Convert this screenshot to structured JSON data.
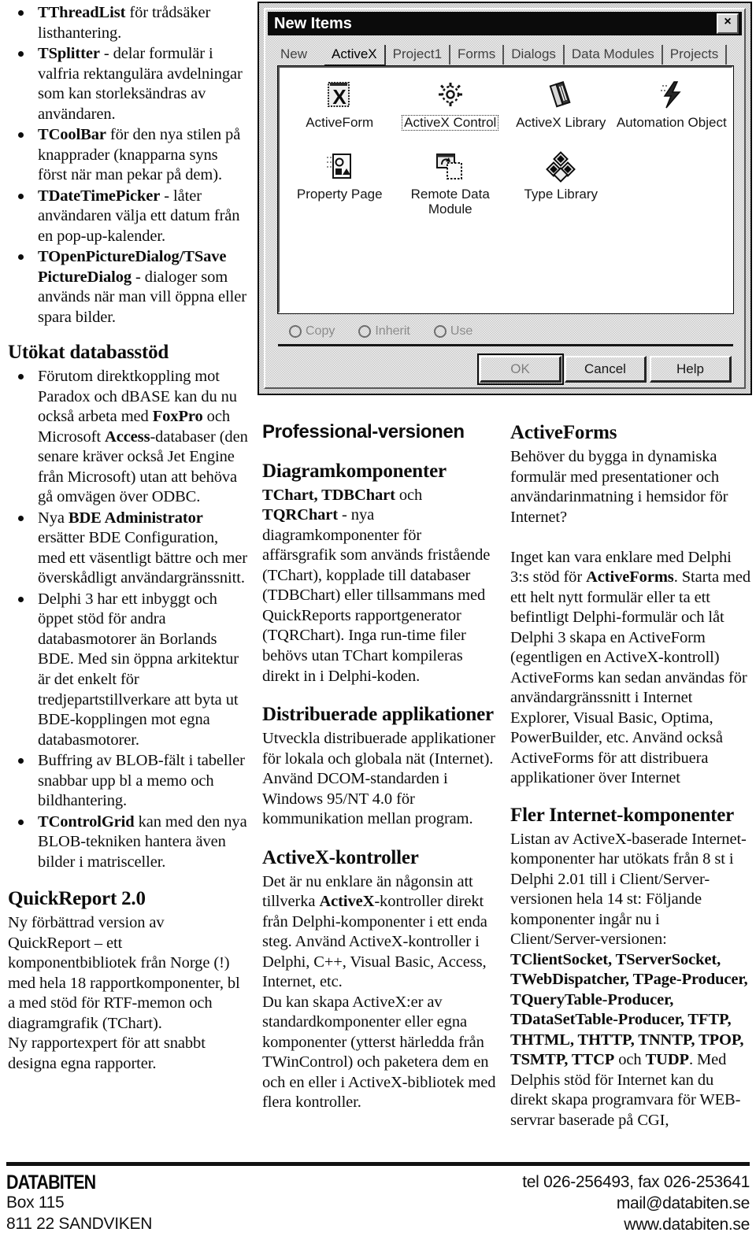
{
  "left_column": {
    "bullets_top": [
      {
        "html": "<b>TThreadList</b> för trådsäker listhantering."
      },
      {
        "html": "<b>TSplitter</b> - delar formulär i valfria rektangulära avdelningar som kan storleksändras av användaren."
      },
      {
        "html": "<b>TCoolBar</b> för den nya stilen på knapprader (knapparna syns först när man pekar på dem)."
      },
      {
        "html": "<b>TDateTimePicker</b> - låter användaren välja ett datum från en pop-up-kalender."
      },
      {
        "html": "<b>TOpenPictureDialog/TSave PictureDialog</b> - dialoger som används när man vill öppna eller spara bilder."
      }
    ],
    "section_db": {
      "heading": "Utökat databasstöd",
      "bullets": [
        {
          "html": "Förutom direktkoppling mot Paradox och dBASE kan du nu också arbeta med <b>FoxPro</b> och Microsoft <b>Access</b>-databaser (den senare kräver också Jet Engine från Microsoft) utan att behöva gå omvägen över ODBC."
        },
        {
          "html": "Nya <b>BDE Administrator</b> ersätter BDE Configuration, med ett väsentligt bättre och mer överskådligt användargränssnitt."
        },
        {
          "html": "Delphi 3 har ett inbyggt och öppet stöd för andra databasmotorer än Borlands BDE. Med sin öppna arkitektur är det enkelt för tredjepartstillverkare att byta ut BDE-kopplingen mot egna databasmotorer."
        },
        {
          "html": "Buffring av BLOB-fält i tabeller snabbar upp bl a memo och bildhantering."
        },
        {
          "html": "<b>TControlGrid</b> kan med den nya BLOB-tekniken hantera även bilder i matrisceller."
        }
      ]
    },
    "section_quickreport": {
      "heading": "QuickReport 2.0",
      "paragraphs": [
        "Ny förbättrad version av QuickReport – ett komponentbibliotek från Norge (!) med hela 18 rapportkomponenter, bl a med stöd för RTF-memon och diagramgrafik (TChart).",
        "Ny rapportexpert för att snabbt designa egna rapporter."
      ]
    }
  },
  "mid_column": {
    "kicker": "Professional-versionen",
    "section_chart": {
      "heading": "Diagramkomponenter",
      "body_html": "<b>TChart, TDBChart</b> och <b>TQRChart</b> - nya diagramkomponenter för affärsgrafik som används fristående (TChart), kopplade till databaser (TDBChart) eller tillsammans med QuickReports rapportgenerator (TQRChart). Inga run-time filer behövs utan TChart kompileras direkt in i Delphi-koden."
    },
    "section_distributed": {
      "heading": "Distribuerade applikationer",
      "body_html": "Utveckla distribuerade applikationer för lokala och globala nät (Internet). Använd DCOM-standarden i Windows 95/NT 4.0 för kommunikation mellan program."
    },
    "section_activex": {
      "heading": "ActiveX-kontroller",
      "body_html": "Det är nu enklare än någonsin att tillverka <b>ActiveX</b>-kontroller direkt från Delphi-komponenter i ett enda steg. Använd ActiveX-kontroller i Delphi, C++, Visual Basic, Access, Internet, etc.<br>Du kan skapa ActiveX:er av standardkomponenter eller egna komponenter (ytterst härledda från TWinControl) och paketera dem en och en eller i ActiveX-bibliotek med flera kontroller."
    }
  },
  "right_column": {
    "section_activeforms": {
      "heading": "ActiveForms",
      "body_html": "Behöver du bygga in dynamiska formulär med presentationer och användarinmatning i hemsidor för Internet?<br><br>Inget kan vara enklare med Delphi 3:s stöd för <b>ActiveForms</b>. Starta med ett helt nytt formulär  eller ta ett befintligt Delphi-formulär och låt Delphi 3 skapa en ActiveForm (egentligen en ActiveX-kontroll) ActiveForms kan sedan användas för användargränssnitt i Internet Explorer, Visual Basic, Optima, PowerBuilder, etc.  Använd också ActiveForms för att distribuera applikationer över Internet"
    },
    "section_internet": {
      "heading": "Fler Internet-komponenter",
      "body_html": "Listan av ActiveX-baserade Internet-komponenter har utökats från 8 st i Delphi 2.01 till i Client/Server-versionen hela 14 st: Följande komponenter ingår nu i Client/Server-versionen: <b>TClientSocket, TServerSocket, TWebDispatcher, TPage-Producer, TQueryTable-Producer, TDataSetTable-Producer, TFTP, THTML, THTTP, TNNTP, TPOP, TSMTP, TTCP</b> och <b>TUDP</b>. Med Delphis stöd för Internet kan du direkt skapa programvara för WEB-servrar baserade på CGI,"
    }
  },
  "dialog": {
    "title": "New Items",
    "close_label": "×",
    "tabs": [
      {
        "label": "New",
        "active": false
      },
      {
        "label": "ActiveX",
        "active": true
      },
      {
        "label": "Project1",
        "active": false
      },
      {
        "label": "Forms",
        "active": false
      },
      {
        "label": "Dialogs",
        "active": false
      },
      {
        "label": "Data Modules",
        "active": false
      },
      {
        "label": "Projects",
        "active": false
      }
    ],
    "items": [
      {
        "label": "ActiveForm",
        "icon": "activeform-icon",
        "selected": false
      },
      {
        "label": "ActiveX Control",
        "icon": "activex-control-icon",
        "selected": true
      },
      {
        "label": "ActiveX Library",
        "icon": "activex-library-icon",
        "selected": false
      },
      {
        "label": "Automation Object",
        "icon": "automation-object-icon",
        "selected": false
      },
      {
        "label": "Property Page",
        "icon": "property-page-icon",
        "selected": false
      },
      {
        "label": "Remote Data\nModule",
        "icon": "remote-data-module-icon",
        "selected": false
      },
      {
        "label": "Type Library",
        "icon": "type-library-icon",
        "selected": false
      }
    ],
    "radios": [
      {
        "label": "Copy"
      },
      {
        "label": "Inherit"
      },
      {
        "label": "Use"
      }
    ],
    "buttons": [
      {
        "label": "OK",
        "state": "default-dim"
      },
      {
        "label": "Cancel",
        "state": "normal"
      },
      {
        "label": "Help",
        "state": "normal"
      }
    ]
  },
  "footer": {
    "company": "DATABITEN",
    "address_line1": "Box 115",
    "address_line2": "811 22  SANDVIKEN",
    "contact_phone": "tel 026-256493, fax 026-253641",
    "contact_mail": "mail@databiten.se",
    "contact_web": "www.databiten.se"
  }
}
